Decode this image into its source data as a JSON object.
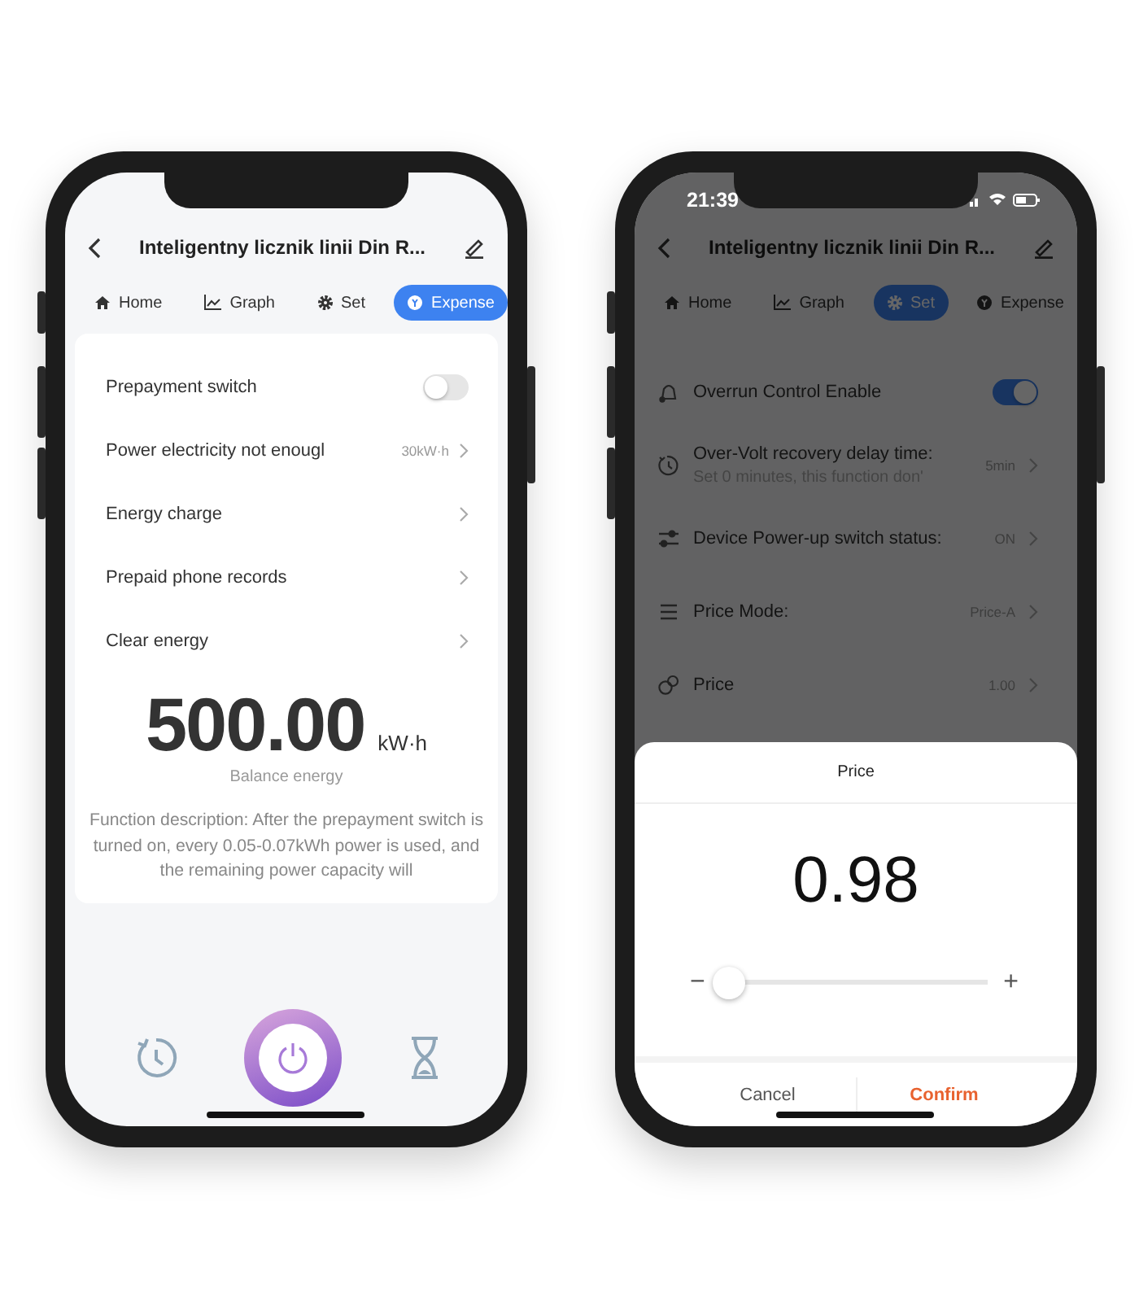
{
  "phones": [
    {
      "title": "Inteligentny licznik linii Din R...",
      "tabs": [
        {
          "label": "Home",
          "selected": false
        },
        {
          "label": "Graph",
          "selected": false
        },
        {
          "label": "Set",
          "selected": false
        },
        {
          "label": "Expense",
          "selected": true
        }
      ],
      "rows": [
        {
          "kind": "toggle",
          "label": "Prepayment switch",
          "on": false
        },
        {
          "kind": "link",
          "label": "Power electricity not enougl",
          "value": "30kW·h"
        },
        {
          "kind": "link",
          "label": "Energy charge"
        },
        {
          "kind": "link",
          "label": "Prepaid phone records"
        },
        {
          "kind": "link",
          "label": "Clear energy"
        }
      ],
      "balance": {
        "value": "500.00",
        "unit": "kW·h",
        "label": "Balance energy"
      },
      "description": "Function description: After the prepayment switch is turned on, every 0.05-0.07kWh power is used, and the remaining power capacity will",
      "bottom_bar": true
    },
    {
      "time": "21:39",
      "title": "Inteligentny licznik linii Din R...",
      "row_icons": true,
      "tabs": [
        {
          "label": "Home",
          "selected": false
        },
        {
          "label": "Graph",
          "selected": false
        },
        {
          "label": "Set",
          "selected": true
        },
        {
          "label": "Expense",
          "selected": false
        }
      ],
      "rows": [
        {
          "kind": "toggle",
          "label": "Overrun Control Enable",
          "on": true
        },
        {
          "kind": "link",
          "label": "Over-Volt recovery delay time:",
          "sublabel": "Set 0 minutes, this function don'",
          "value": "5min"
        },
        {
          "kind": "link",
          "label": "Device Power-up switch status:",
          "value": "ON"
        },
        {
          "kind": "link",
          "label": "Price Mode:",
          "value": "Price-A"
        },
        {
          "kind": "link",
          "label": "Price",
          "value": "1.00"
        }
      ],
      "dialog": {
        "title": "Price",
        "value": "0.98",
        "minus": "−",
        "plus": "+",
        "slider": {
          "level": 0.03
        },
        "buttons": [
          {
            "label": "Cancel",
            "kind": "plain"
          },
          {
            "label": "Confirm",
            "kind": "primary"
          }
        ]
      }
    }
  ]
}
